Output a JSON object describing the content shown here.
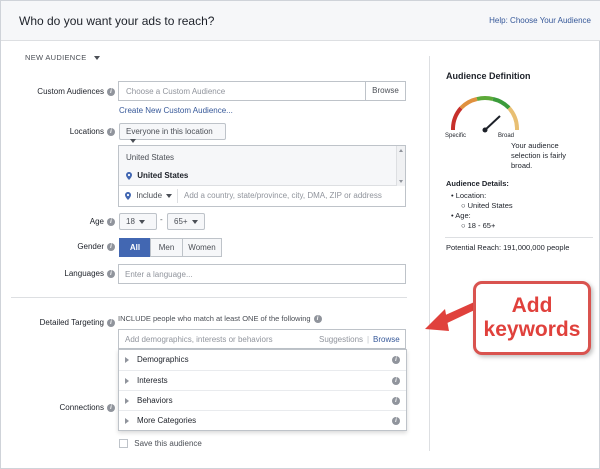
{
  "header": {
    "title": "Who do you want your ads to reach?",
    "help": "Help: Choose Your Audience"
  },
  "new_audience": "NEW AUDIENCE",
  "custom_audiences": {
    "label": "Custom Audiences",
    "placeholder": "Choose a Custom Audience",
    "browse": "Browse",
    "create_link": "Create New Custom Audience..."
  },
  "locations": {
    "label": "Locations",
    "dropdown": "Everyone in this location",
    "country_header": "United States",
    "selected": "United States",
    "include": "Include",
    "placeholder": "Add a country, state/province, city, DMA, ZIP or address"
  },
  "age": {
    "label": "Age",
    "min": "18",
    "max": "65+",
    "dash": "-"
  },
  "gender": {
    "label": "Gender",
    "options": [
      "All",
      "Men",
      "Women"
    ]
  },
  "languages": {
    "label": "Languages",
    "placeholder": "Enter a language..."
  },
  "detailed_targeting": {
    "label": "Detailed Targeting",
    "include_text": "INCLUDE people who match at least ONE of the following",
    "placeholder": "Add demographics, interests or behaviors",
    "suggestions": "Suggestions",
    "separator": "|",
    "browse": "Browse",
    "categories": [
      "Demographics",
      "Interests",
      "Behaviors",
      "More Categories"
    ]
  },
  "connections": {
    "label": "Connections"
  },
  "save": {
    "label": "Save this audience"
  },
  "definition": {
    "title": "Audience Definition",
    "specific": "Specific",
    "broad": "Broad",
    "description": "Your audience selection is fairly broad.",
    "details_title": "Audience Details:",
    "location_label": "Location:",
    "location_value": "United States",
    "age_label": "Age:",
    "age_value": "18 - 65+",
    "reach": "Potential Reach: 191,000,000 people"
  },
  "callout": {
    "line1": "Add",
    "line2": "keywords"
  },
  "colors": {
    "accent": "#4267b2",
    "link": "#365899",
    "callout_red": "#e0413c"
  }
}
